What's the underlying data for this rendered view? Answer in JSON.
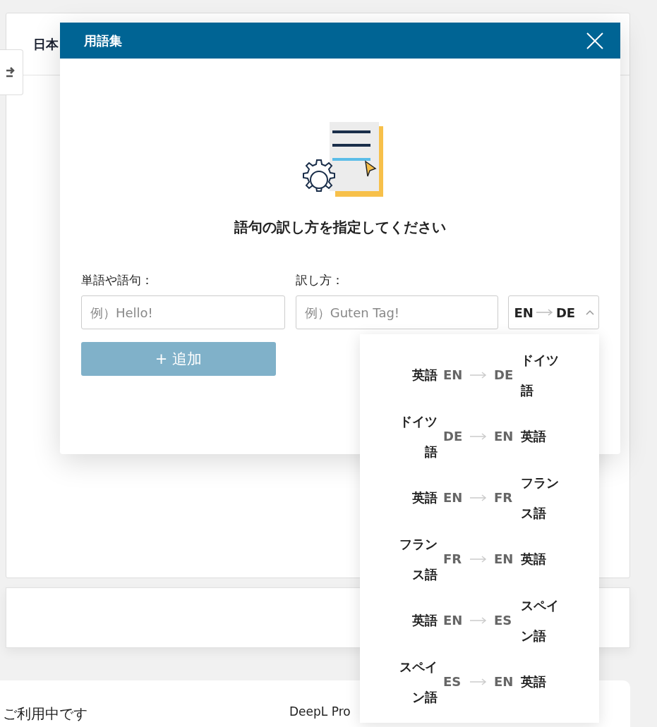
{
  "background": {
    "panel_heading": "日本",
    "status_text": "ご利用中です",
    "promo_text": "DeepL Pro"
  },
  "dialog": {
    "title": "用語集",
    "heading": "語句の訳し方を指定してください",
    "term_label": "単語や語句：",
    "term_placeholder": "例）Hello!",
    "translation_label": "訳し方：",
    "translation_placeholder": "例）Guten Tag!",
    "language_pair": {
      "source": "EN",
      "target": "DE",
      "expanded": true
    },
    "add_button": {
      "label": "+ 追加",
      "disabled": true
    }
  },
  "language_options": [
    {
      "source_name": "英語",
      "source_code": "EN",
      "target_code": "DE",
      "target_name": "ドイツ語"
    },
    {
      "source_name": "ドイツ語",
      "source_code": "DE",
      "target_code": "EN",
      "target_name": "英語"
    },
    {
      "source_name": "英語",
      "source_code": "EN",
      "target_code": "FR",
      "target_name": "フランス語"
    },
    {
      "source_name": "フランス語",
      "source_code": "FR",
      "target_code": "EN",
      "target_name": "英語"
    },
    {
      "source_name": "英語",
      "source_code": "EN",
      "target_code": "ES",
      "target_name": "スペイン語"
    },
    {
      "source_name": "スペイン語",
      "source_code": "ES",
      "target_code": "EN",
      "target_name": "英語"
    }
  ]
}
